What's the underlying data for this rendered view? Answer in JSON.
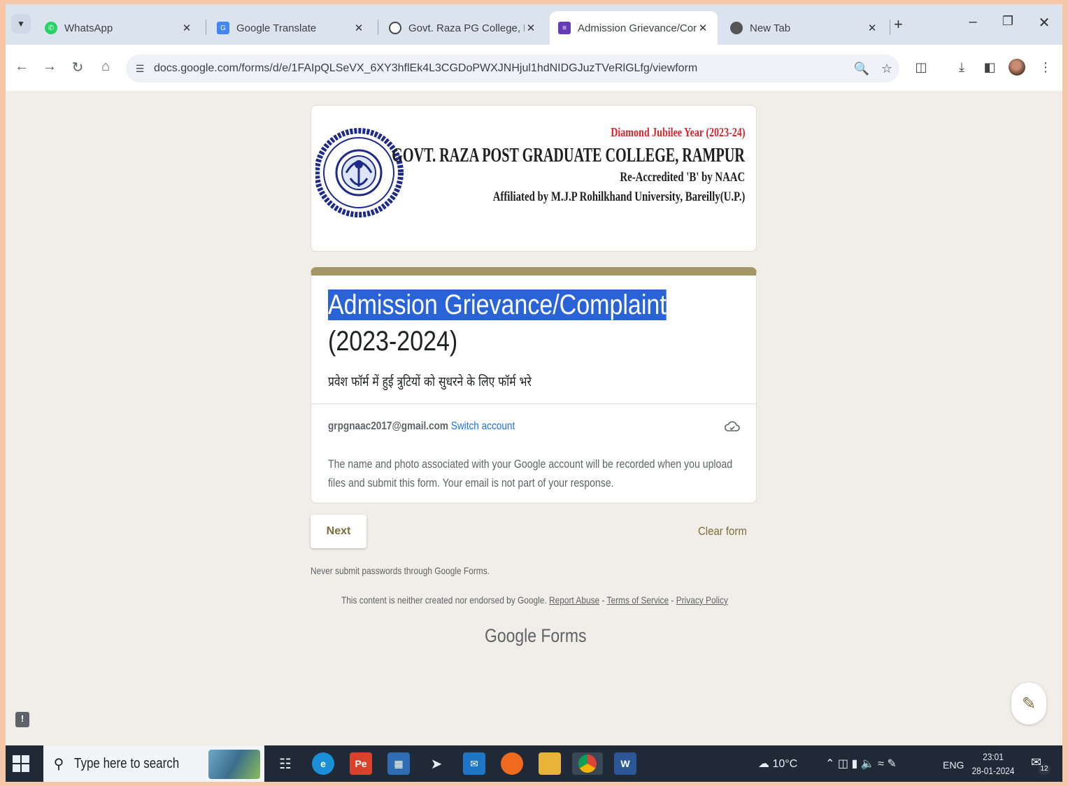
{
  "browser": {
    "tabs": [
      {
        "title": "WhatsApp",
        "icon": "whatsapp-icon",
        "color": "#25d366"
      },
      {
        "title": "Google Translate",
        "icon": "google-translate-icon",
        "color": "#4285f4"
      },
      {
        "title": "Govt. Raza PG College, Ram",
        "icon": "globe-icon",
        "color": "#444444"
      },
      {
        "title": "Admission Grievance/Comp",
        "icon": "google-forms-icon",
        "color": "#673ab7",
        "active": true
      },
      {
        "title": "New Tab",
        "icon": "chrome-icon",
        "color": "#444444"
      }
    ],
    "url": "docs.google.com/forms/d/e/1FAIpQLSeVX_6XY3hflEk4L3CGDoPWXJNHjul1hdNIDGJuzTVeRlGLfg/viewform"
  },
  "header": {
    "jubilee": "Diamond Jubilee Year (2023-24)",
    "college": "GOVT. RAZA POST GRADUATE COLLEGE, RAMPUR",
    "accreditation": "Re-Accredited 'B' by NAAC",
    "affiliation": "Affiliated by M.J.P Rohilkhand University, Bareilly(U.P.)"
  },
  "form": {
    "title_selected": "Admission  Grievance/Complaint",
    "title_rest": " (2023-2024)",
    "description": "प्रवेश फॉर्म में हुई त्रुटियों को सुधरने के लिए फॉर्म भरे",
    "email": "grpgnaac2017@gmail.com",
    "switch_account": "Switch account",
    "notice": "The name and photo associated with your Google account will be recorded when you upload files and submit this form. Your email is not part of your response.",
    "next_label": "Next",
    "clear_label": "Clear form",
    "never_submit": "Never submit passwords through Google Forms.",
    "disclaimer": "This content is neither created nor endorsed by Google.",
    "report_abuse": "Report Abuse",
    "terms": "Terms of Service",
    "privacy": "Privacy Policy",
    "sep": " - ",
    "logo_google": "Google",
    "logo_forms": "Forms"
  },
  "taskbar": {
    "search_placeholder": "Type here to search",
    "weather": "10°C",
    "language": "ENG",
    "time": "23:01",
    "date": "28-01-2024",
    "notification_count": "12"
  },
  "colors": {
    "accent": "#a49666",
    "form_button_text": "#7d6d3a",
    "selection": "#2a63d8",
    "jubilee_red": "#e0202a"
  }
}
